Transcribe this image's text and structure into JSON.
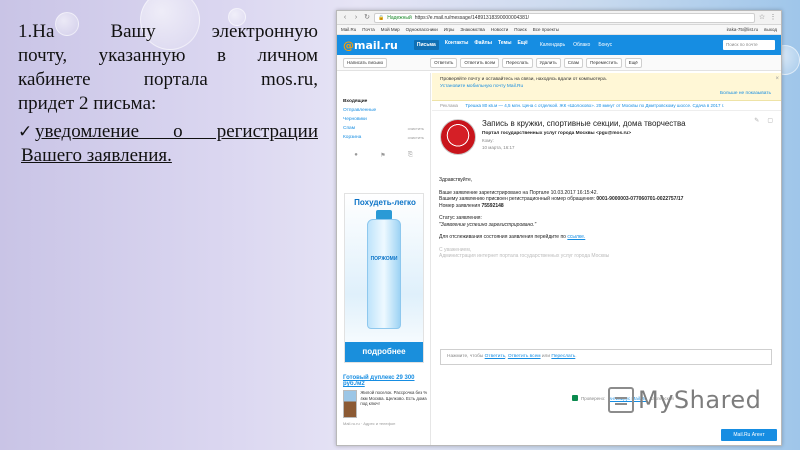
{
  "slide": {
    "para_lines": [
      "1.На Вашу электронную",
      "почту, указанную в личном",
      "кабинете портала mos.ru,"
    ],
    "para_last": "придет 2 письма:",
    "bullet_line1": "уведомление о регистрации",
    "bullet_line2": "Вашего заявления."
  },
  "browser": {
    "secure_label": "Надежный",
    "url": "https://e.mail.ru/message/14891318390000004381/"
  },
  "portal_bar": {
    "items": [
      "Mail.Ru",
      "Почта",
      "Мой Мир",
      "Одноклассники",
      "Игры",
      "Знакомства",
      "Новости",
      "Поиск",
      "Все проекты"
    ],
    "user": "irakа-75@list.ru",
    "logout": "выход"
  },
  "header": {
    "logo_at": "@",
    "logo_text": "mail.ru",
    "tabs": [
      "Письма",
      "Контакты",
      "Файлы",
      "Темы",
      "Ещё"
    ],
    "services": [
      "Календарь",
      "Облако",
      "Бонус"
    ],
    "search_placeholder": "Поиск по почте"
  },
  "toolbar": {
    "compose": "Написать письмо",
    "buttons": [
      "Ответить",
      "Ответить всем",
      "Переслать",
      "Удалить",
      "Спам",
      "Переместить",
      "Ещё"
    ]
  },
  "sidebar": {
    "folders": [
      {
        "name": "Входящие",
        "action": ""
      },
      {
        "name": "Отправленные",
        "action": ""
      },
      {
        "name": "Черновики",
        "action": ""
      },
      {
        "name": "Спам",
        "action": "очистить"
      },
      {
        "name": "Корзина",
        "action": "очистить"
      }
    ],
    "ad_title": "Похудеть-легко",
    "ad_brand": "ПОРЖОМИ",
    "ad_button": "подробнее",
    "ad2_title": "Готовый дуплекс 29 300 руб./м2",
    "ad2_text": "Жилой поселок. Рассрочка без % 4км Москва. Щелково. Есть дома под ключ!",
    "ad2_foot": "Mail.ru.ru · Адрес и телефон"
  },
  "notice": {
    "line1": "Проверяйте почту и оставайтесь на связи, находясь вдали от компьютера.",
    "line2": "Установите мобильную почту Mail.Ru",
    "hide": "Больше не показывать"
  },
  "adline": {
    "label": "Реклама",
    "text": "Трешка 80 кв.м — 4,5 млн. Цена с отделкой. ЖК «Шолохово». 20 минут от Москвы по Дмитровскому шоссе. Сдача в 2017 г."
  },
  "message": {
    "subject": "Запись в кружки, спортивные секции, дома творчества",
    "from": "Портал государственных услуг города Москвы <pgu@mos.ru>",
    "to": "Кому:",
    "date": "10 марта, 16:17",
    "greeting": "Здравствуйте,",
    "line1": "Ваше заявление зарегистрировано на Портале 10.03.2017 16:15:42.",
    "line2_prefix": "Вашему заявлению присвоен регистрационный номер обращения:",
    "reg_number": "0001-9000003-077060701-0022757/17",
    "line3_prefix": "Номер заявления",
    "app_number": "75592148",
    "status_label": "Статус заявления:",
    "status_value": "\"Заявление успешно зарегистрировано.\"",
    "track_prefix": "Для отслеживания состояния заявления перейдите по",
    "track_link": "ссылке.",
    "regards": "С уважением,",
    "signature": "Администрация интернет портала государственных услуг города Москвы",
    "reply_prefix": "Нажмите, чтобы",
    "reply_links": [
      "Ответить",
      "Ответить всем",
      "Переслать"
    ],
    "check_prefix": "Проверено:",
    "check_link": "Антивирус Mail.Ru",
    "check_suffix": "Касперский",
    "agent": "Mail.Ru Агент"
  },
  "watermark": "MyShared"
}
